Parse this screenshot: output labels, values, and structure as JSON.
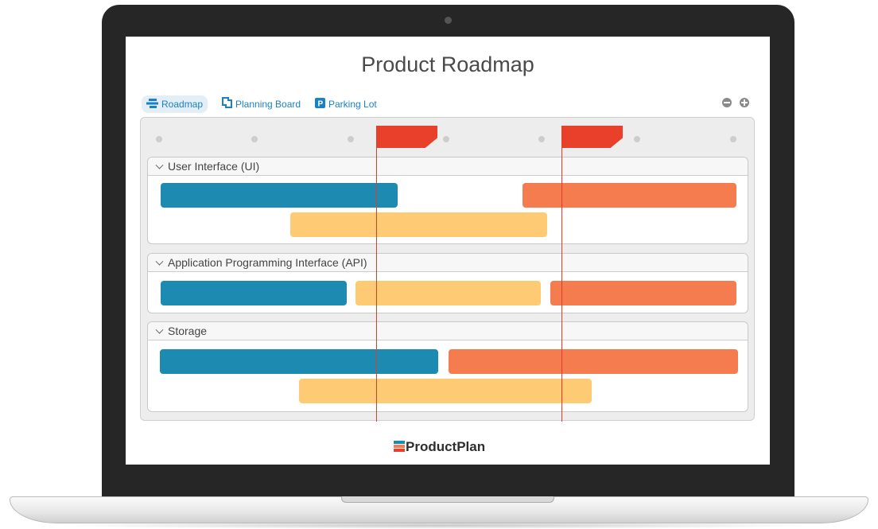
{
  "page": {
    "title": "Product Roadmap"
  },
  "tabs": [
    {
      "label": "Roadmap",
      "active": true,
      "icon": "roadmap-icon"
    },
    {
      "label": "Planning Board",
      "active": false,
      "icon": "planning-board-icon"
    },
    {
      "label": "Parking Lot",
      "active": false,
      "icon": "parking-lot-icon"
    }
  ],
  "zoom": {
    "out_icon": "zoom-out-icon",
    "in_icon": "zoom-in-icon"
  },
  "lanes": [
    {
      "name": "User Interface (UI)",
      "expanded": true
    },
    {
      "name": "Application Programming Interface (API)",
      "expanded": true
    },
    {
      "name": "Storage",
      "expanded": true
    }
  ],
  "colors": {
    "blue": "#1c8ab1",
    "orange": "#f57c4f",
    "yellow": "#fecb74",
    "marker": "#e8402a",
    "link": "#1a82c4"
  },
  "brand": {
    "name": "ProductPlan"
  }
}
